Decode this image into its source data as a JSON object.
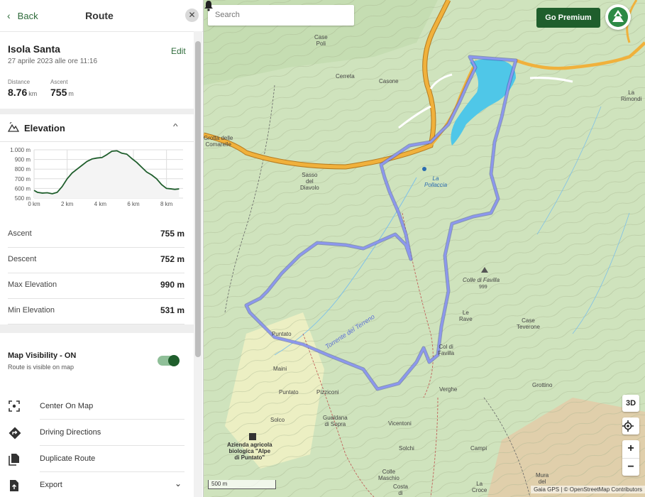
{
  "nav": {
    "back_label": "Back",
    "title": "Route",
    "close_symbol": "✕"
  },
  "route": {
    "name": "Isola Santa",
    "date": "27 aprile 2023 alle ore 11:16",
    "edit_label": "Edit",
    "distance_label": "Distance",
    "distance_value": "8.76",
    "distance_unit": "km",
    "ascent_label": "Ascent",
    "ascent_value": "755",
    "ascent_unit": "m"
  },
  "elevation": {
    "title": "Elevation",
    "caret": "^"
  },
  "chart_data": {
    "type": "area",
    "x": [
      0,
      0.2,
      0.5,
      0.8,
      1.1,
      1.4,
      1.7,
      2.0,
      2.3,
      2.6,
      2.9,
      3.2,
      3.5,
      3.8,
      4.1,
      4.4,
      4.7,
      5.0,
      5.3,
      5.6,
      5.9,
      6.2,
      6.5,
      6.8,
      7.1,
      7.4,
      7.7,
      8.0,
      8.3,
      8.5,
      8.76
    ],
    "y": [
      580,
      560,
      552,
      555,
      545,
      560,
      620,
      700,
      760,
      800,
      840,
      880,
      905,
      915,
      920,
      950,
      985,
      990,
      965,
      955,
      910,
      870,
      820,
      770,
      740,
      700,
      640,
      600,
      595,
      590,
      595
    ],
    "xticks": [
      "0 km",
      "2 km",
      "4 km",
      "6 km",
      "8 km"
    ],
    "xtick_values": [
      0,
      2,
      4,
      6,
      8
    ],
    "yticks": [
      "1.000 m",
      "900 m",
      "800 m",
      "700 m",
      "600 m",
      "500 m"
    ],
    "ytick_values": [
      1000,
      900,
      800,
      700,
      600,
      500
    ],
    "xlim": [
      0,
      9.0
    ],
    "ylim": [
      500,
      1000
    ],
    "grid": true,
    "line_color": "#1f5e2c",
    "fill_color": "#f4f4f4"
  },
  "stats": [
    {
      "label": "Ascent",
      "value": "755 m"
    },
    {
      "label": "Descent",
      "value": "752 m"
    },
    {
      "label": "Max Elevation",
      "value": "990 m"
    },
    {
      "label": "Min Elevation",
      "value": "531 m"
    }
  ],
  "visibility": {
    "title": "Map Visibility - ON",
    "subtitle": "Route is visible on map",
    "on": true
  },
  "actions": [
    {
      "label": "Center On Map",
      "icon": "center-focus-icon"
    },
    {
      "label": "Driving Directions",
      "icon": "directions-icon"
    },
    {
      "label": "Duplicate Route",
      "icon": "duplicate-icon"
    },
    {
      "label": "Export",
      "icon": "export-icon",
      "more": "⌄"
    }
  ],
  "map": {
    "search_placeholder": "Search",
    "premium_label": "Go Premium",
    "btn_3d": "3D",
    "zoom_in": "+",
    "zoom_out": "−",
    "scale": "500 m",
    "attribution": "Gaia GPS | © OpenStreetMap Contributors",
    "places": {
      "case_poli": "Case\nPoli",
      "cerreta": "Cerreta",
      "casone": "Casone",
      "grotta": "Grotta delle\nComarelle",
      "sasso": "Sasso\ndel\nDiavolo",
      "la_rimondi": "La\nRimondi",
      "la_pollaccia": "La\nPollaccia",
      "colle_favilla": "Colle di Favilla",
      "colle_favilla_elev": "999",
      "le_rave": "Le\nRave",
      "case_teverone": "Case\nTeverone",
      "col_favilla": "Col di\nFavilla",
      "puntato1": "Puntato",
      "maini": "Maini",
      "puntato2": "Puntato",
      "pizziconi": "Pizziconi",
      "verghe": "Verghe",
      "grottino": "Grottino",
      "solco": "Solco",
      "gualdana": "Gualdana\ndi Sopra",
      "vicentoni": "Vicentoni",
      "azienda": "Azienda agricola\nbiologica \"Alpe\ndi Puntato\"",
      "solchi": "Solchi",
      "campi": "Campi",
      "colle_maschio": "Colle\nMaschio",
      "costa": "Costa\ndi",
      "la_croce": "La\nCroce",
      "mura": "Mura\ndel",
      "torrente": "Torrente del Terreno"
    },
    "colors": {
      "route": "#6f7de0",
      "road": "#f0b13c",
      "lake": "#4fc7e8",
      "terrain": "#cfe3bd"
    }
  }
}
